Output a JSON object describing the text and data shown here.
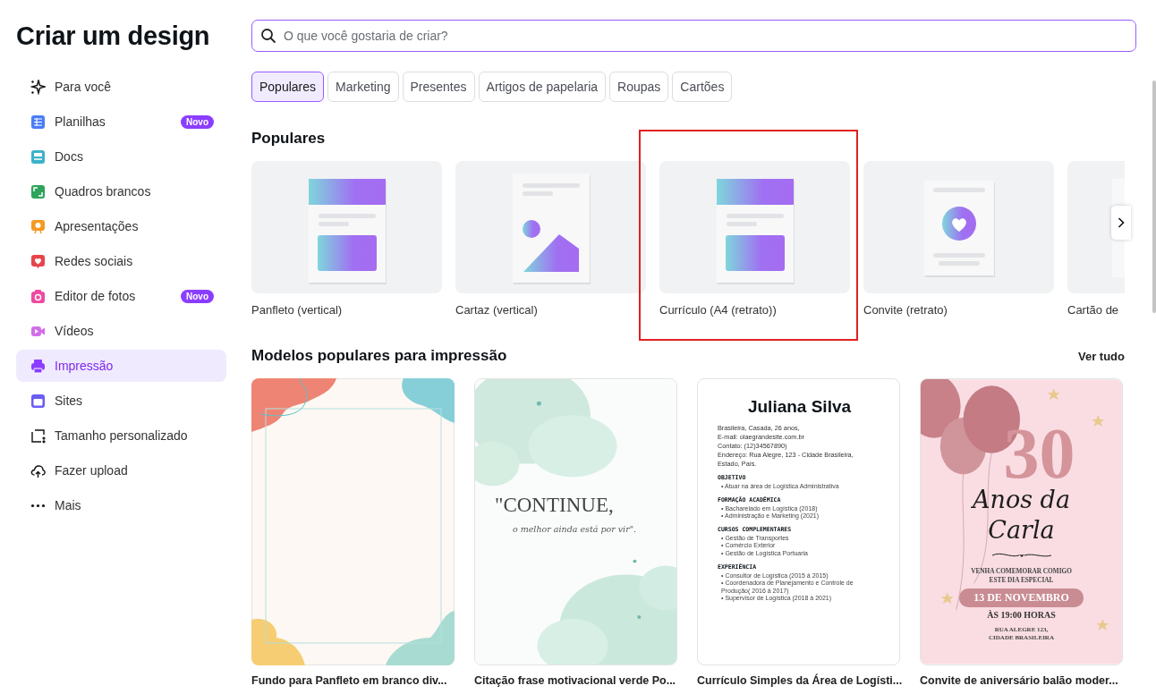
{
  "sidebar": {
    "title": "Criar um design",
    "items": [
      {
        "label": "Para você",
        "selected": false
      },
      {
        "label": "Planilhas",
        "selected": false,
        "badge": "Novo"
      },
      {
        "label": "Docs",
        "selected": false
      },
      {
        "label": "Quadros brancos",
        "selected": false
      },
      {
        "label": "Apresentações",
        "selected": false
      },
      {
        "label": "Redes sociais",
        "selected": false
      },
      {
        "label": "Editor de fotos",
        "selected": false,
        "badge": "Novo"
      },
      {
        "label": "Vídeos",
        "selected": false
      },
      {
        "label": "Impressão",
        "selected": true
      },
      {
        "label": "Sites",
        "selected": false
      },
      {
        "label": "Tamanho personalizado",
        "selected": false
      },
      {
        "label": "Fazer upload",
        "selected": false
      },
      {
        "label": "Mais",
        "selected": false
      }
    ]
  },
  "search": {
    "placeholder": "O que você gostaria de criar?"
  },
  "tabs": [
    {
      "label": "Populares",
      "selected": true
    },
    {
      "label": "Marketing",
      "selected": false
    },
    {
      "label": "Presentes",
      "selected": false
    },
    {
      "label": "Artigos de papelaria",
      "selected": false
    },
    {
      "label": "Roupas",
      "selected": false
    },
    {
      "label": "Cartões",
      "selected": false
    }
  ],
  "popular": {
    "title": "Populares",
    "items": [
      {
        "label": "Panfleto (vertical)",
        "kind": "flyer",
        "highlighted": false
      },
      {
        "label": "Cartaz (vertical)",
        "kind": "poster",
        "highlighted": false
      },
      {
        "label": "Currículo (A4 (retrato))",
        "kind": "resume",
        "highlighted": true
      },
      {
        "label": "Convite (retrato)",
        "kind": "invite",
        "highlighted": false
      },
      {
        "label": "Cartão de",
        "kind": "card",
        "highlighted": false
      }
    ]
  },
  "templates": {
    "title": "Modelos populares para impressão",
    "see_all": "Ver tudo",
    "items": [
      {
        "title": "Fundo para Panfleto em branco div...",
        "kind": "frame"
      },
      {
        "title": "Citação frase motivacional verde Po...",
        "kind": "quote",
        "lines": [
          "\"CONTINUE,",
          "o melhor ainda está por vir\"."
        ]
      },
      {
        "title": "Currículo Simples da Área de Logísti...",
        "kind": "resume",
        "name": "Juliana Silva",
        "info": [
          "Brasileira, Casada, 26 anos,",
          "E-mail: olaegrandesite.com.br",
          "Contato: (12)34567890)",
          "Endereço: Rua Alegre, 123 - Cidade Brasileira,",
          "Estado, País."
        ],
        "sections": [
          {
            "heading": "OBJETIVO",
            "items": [
              "• Atuar na área de Logística Administrativa"
            ]
          },
          {
            "heading": "FORMAÇÃO ACADÊMICA",
            "items": [
              "• Bacharelado em Logística (2018)",
              "• Administração e Marketing (2021)"
            ]
          },
          {
            "heading": "CURSOS COMPLEMENTARES",
            "items": [
              "• Gestão de Transportes",
              "• Comércio Exterior",
              "• Gestão de Logística Portuaria"
            ]
          },
          {
            "heading": "EXPERIÊNCIA",
            "items": [
              "• Consultor de Logística (2015 à 2015)",
              "• Coordenadora de Planejamento e Controle de Produção( 2016 à 2017)",
              "• Supervisor de Logística (2018 à 2021)"
            ]
          }
        ]
      },
      {
        "title": "Convite de aniversário balão moder...",
        "kind": "invitation",
        "number": "30",
        "script": [
          "Anos da",
          "Carla"
        ],
        "lines": [
          "VENHA COMEMORAR COMIGO",
          "ESTE DIA ESPECIAL"
        ],
        "date": "13 DE NOVEMBRO",
        "time": "ÀS 19:00 HORAS",
        "address": [
          "RUA ALEGRE 123,",
          "CIDADE BRASILEIRA"
        ]
      }
    ]
  }
}
